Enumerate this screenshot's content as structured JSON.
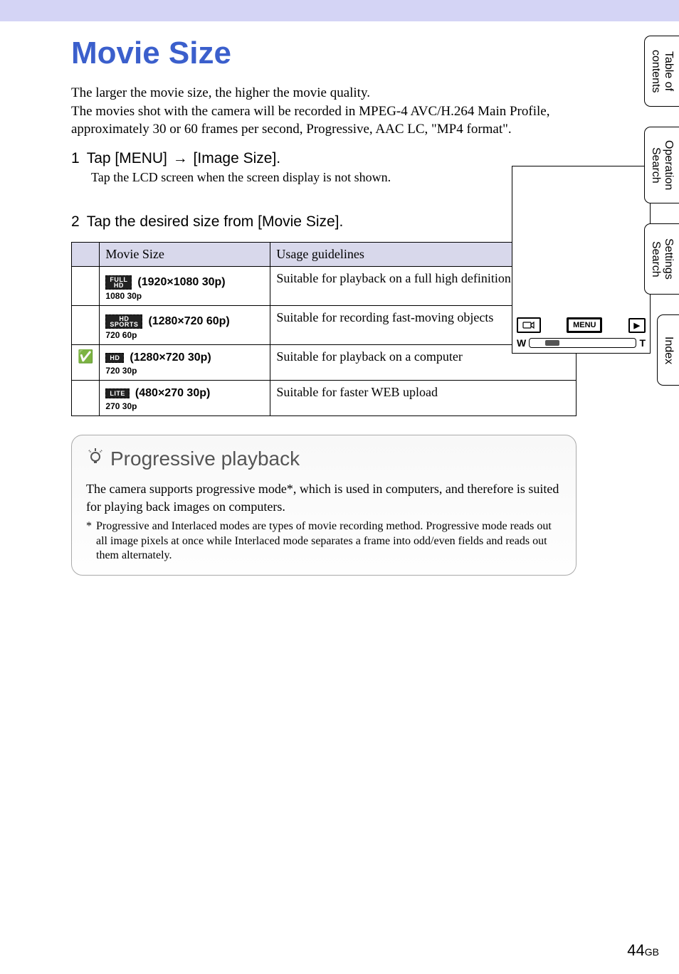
{
  "title": "Movie Size",
  "intro_para1": "The larger the movie size, the higher the movie quality.",
  "intro_para2": "The movies shot with the camera will be recorded in MPEG-4 AVC/H.264 Main Profile, approximately 30 or 60 frames per second, Progressive, AAC LC, \"MP4 format\".",
  "step1": {
    "num": "1",
    "prefix": "Tap [MENU] ",
    "arrow": "→",
    "suffix": " [Image Size].",
    "sub": "Tap the LCD screen when the screen display is not shown."
  },
  "lcd": {
    "mode_icon_label": "mode-icon",
    "menu_label": "MENU",
    "play_label": "▶",
    "w_label": "W",
    "t_label": "T"
  },
  "step2": {
    "num": "2",
    "text": "Tap the desired size from [Movie Size]."
  },
  "table": {
    "headers": {
      "col1": "",
      "col2": "Movie Size",
      "col3": "Usage guidelines"
    },
    "rows": [
      {
        "checked": "",
        "badge_top": "FULL",
        "badge_bottom": "HD",
        "size": "(1920×1080 30p)",
        "sub": "1080 30p",
        "usage": "Suitable for playback on a full high definition TV"
      },
      {
        "checked": "",
        "badge_top": "HD",
        "badge_bottom": "SPORTS",
        "size": "(1280×720 60p)",
        "sub": "720 60p",
        "usage": "Suitable for recording fast-moving objects"
      },
      {
        "checked": "✅",
        "badge_top": "HD",
        "badge_bottom": "",
        "size": "(1280×720 30p)",
        "sub": "720 30p",
        "usage": "Suitable for playback on a computer"
      },
      {
        "checked": "",
        "badge_top": "LITE",
        "badge_bottom": "",
        "size": "(480×270 30p)",
        "sub": "270 30p",
        "usage": "Suitable for faster WEB upload"
      }
    ]
  },
  "tip": {
    "title": "Progressive playback",
    "body": "The camera supports progressive mode*, which is used in computers, and therefore is suited for playing back images on computers.",
    "footnote_marker": "*",
    "footnote": "Progressive and Interlaced modes are types of movie recording method. Progressive mode reads out all image pixels at once while Interlaced mode separates a frame into odd/even fields and reads out them alternately."
  },
  "side_tabs": {
    "toc": "Table of\ncontents",
    "op": "Operation\nSearch",
    "settings": "Settings\nSearch",
    "index": "Index"
  },
  "page": {
    "num": "44",
    "suffix": "GB"
  }
}
